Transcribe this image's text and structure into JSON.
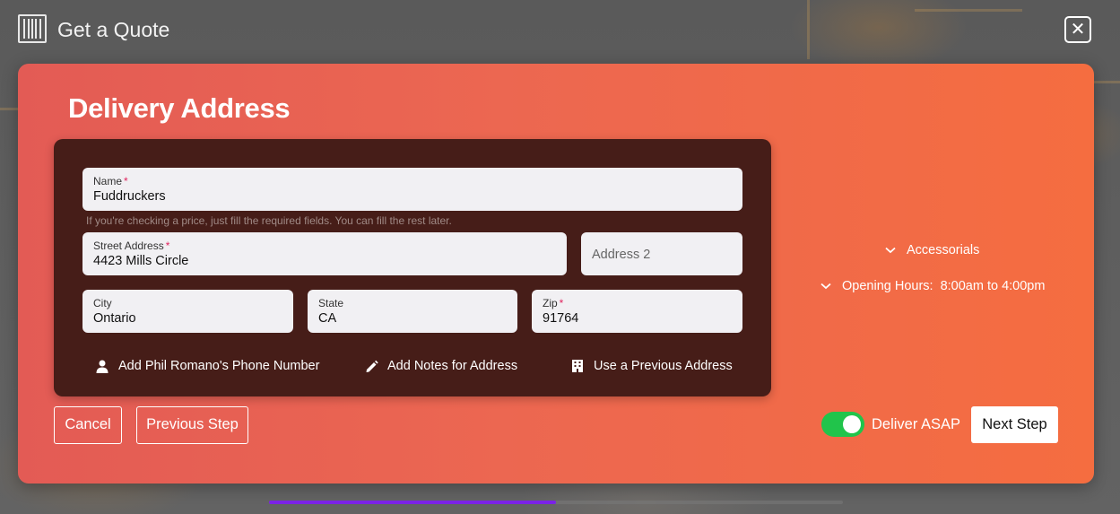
{
  "header": {
    "title": "Get a Quote",
    "close_icon": "close-icon",
    "logo_icon": "container-icon"
  },
  "panel": {
    "title": "Delivery Address",
    "hint": "If you're checking a price, just fill the required fields. You can fill the rest later.",
    "fields": {
      "name": {
        "label": "Name",
        "required": "*",
        "value": "Fuddruckers"
      },
      "street": {
        "label": "Street Address",
        "required": "*",
        "value": "4423 Mills Circle"
      },
      "address2": {
        "placeholder": "Address 2"
      },
      "city": {
        "label": "City",
        "value": "Ontario"
      },
      "state": {
        "label": "State",
        "value": "CA"
      },
      "zip": {
        "label": "Zip",
        "required": "*",
        "value": "91764"
      }
    },
    "actions": {
      "phone": "Add Phil Romano's Phone Number",
      "notes": "Add Notes for Address",
      "previous": "Use a Previous Address"
    },
    "side": {
      "accessorials": "Accessorials",
      "opening_hours_label": "Opening Hours:",
      "opening_hours_value": "8:00am to 4:00pm"
    },
    "buttons": {
      "cancel": "Cancel",
      "previous_step": "Previous Step",
      "next_step": "Next Step"
    },
    "toggle": {
      "label": "Deliver ASAP",
      "on": true
    },
    "colors": {
      "accent_start": "#e35b55",
      "accent_end": "#f56d40",
      "card": "#461d18",
      "toggle_on": "#21c44b",
      "progress": "#7b22e6",
      "required": "#e0245e"
    }
  },
  "progress": {
    "fraction": 0.5
  }
}
